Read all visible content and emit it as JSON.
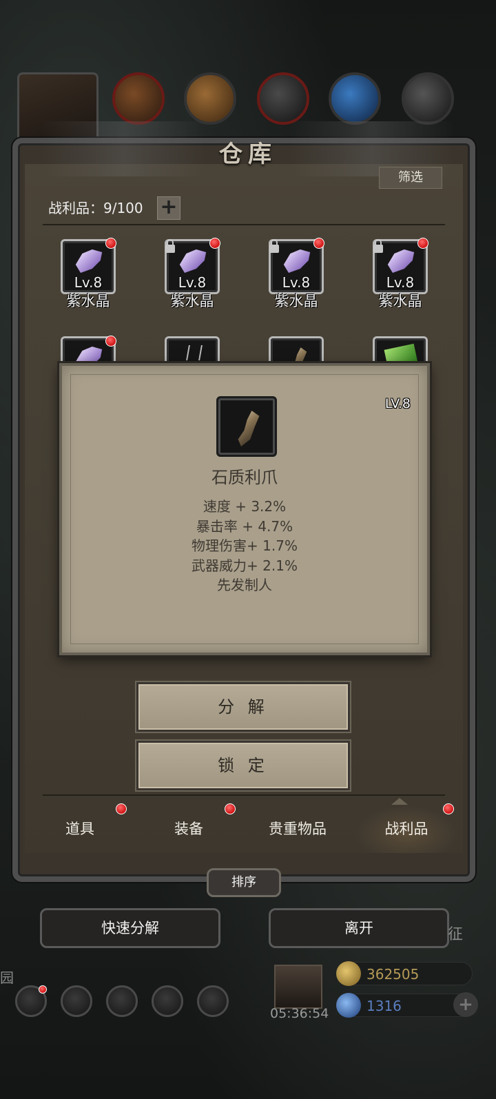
{
  "window": {
    "title": "仓库"
  },
  "header": {
    "filter_label": "筛选",
    "capacity_label": "战利品：9/100",
    "add_symbol": "+"
  },
  "items_row1": [
    {
      "name": "紫水晶",
      "level": "Lv.8",
      "locked": false,
      "new": true
    },
    {
      "name": "紫水晶",
      "level": "Lv.8",
      "locked": true,
      "new": true
    },
    {
      "name": "紫水晶",
      "level": "Lv.8",
      "locked": true,
      "new": true
    },
    {
      "name": "紫水晶",
      "level": "Lv.8",
      "locked": true,
      "new": true
    }
  ],
  "detail": {
    "level": "LV.8",
    "name": "石质利爪",
    "stats": [
      "速度 + 3.2%",
      "暴击率 + 4.7%",
      "物理伤害+ 1.7%",
      "武器威力+ 2.1%",
      "先发制人"
    ],
    "icon": "stone-claw-icon"
  },
  "actions": {
    "decompose": "分 解",
    "lock": "锁 定"
  },
  "tabs": [
    {
      "label": "道具",
      "badge": true
    },
    {
      "label": "装备",
      "badge": true
    },
    {
      "label": "贵重物品",
      "badge": false
    },
    {
      "label": "战利品",
      "badge": true,
      "active": true
    }
  ],
  "sort_label": "排序",
  "bottom_buttons": {
    "quick_decompose": "快速分解",
    "leave": "离开"
  },
  "hud": {
    "left_text": "园",
    "right_text": "征",
    "timer": "05:36:54",
    "gold": "362505",
    "gems": "1316",
    "gold_color": "#b59a55",
    "gem_color": "#5a7fc0"
  },
  "colors": {
    "badge": "#e02020",
    "panel": "#3d372e",
    "popup": "#a99f8b"
  }
}
